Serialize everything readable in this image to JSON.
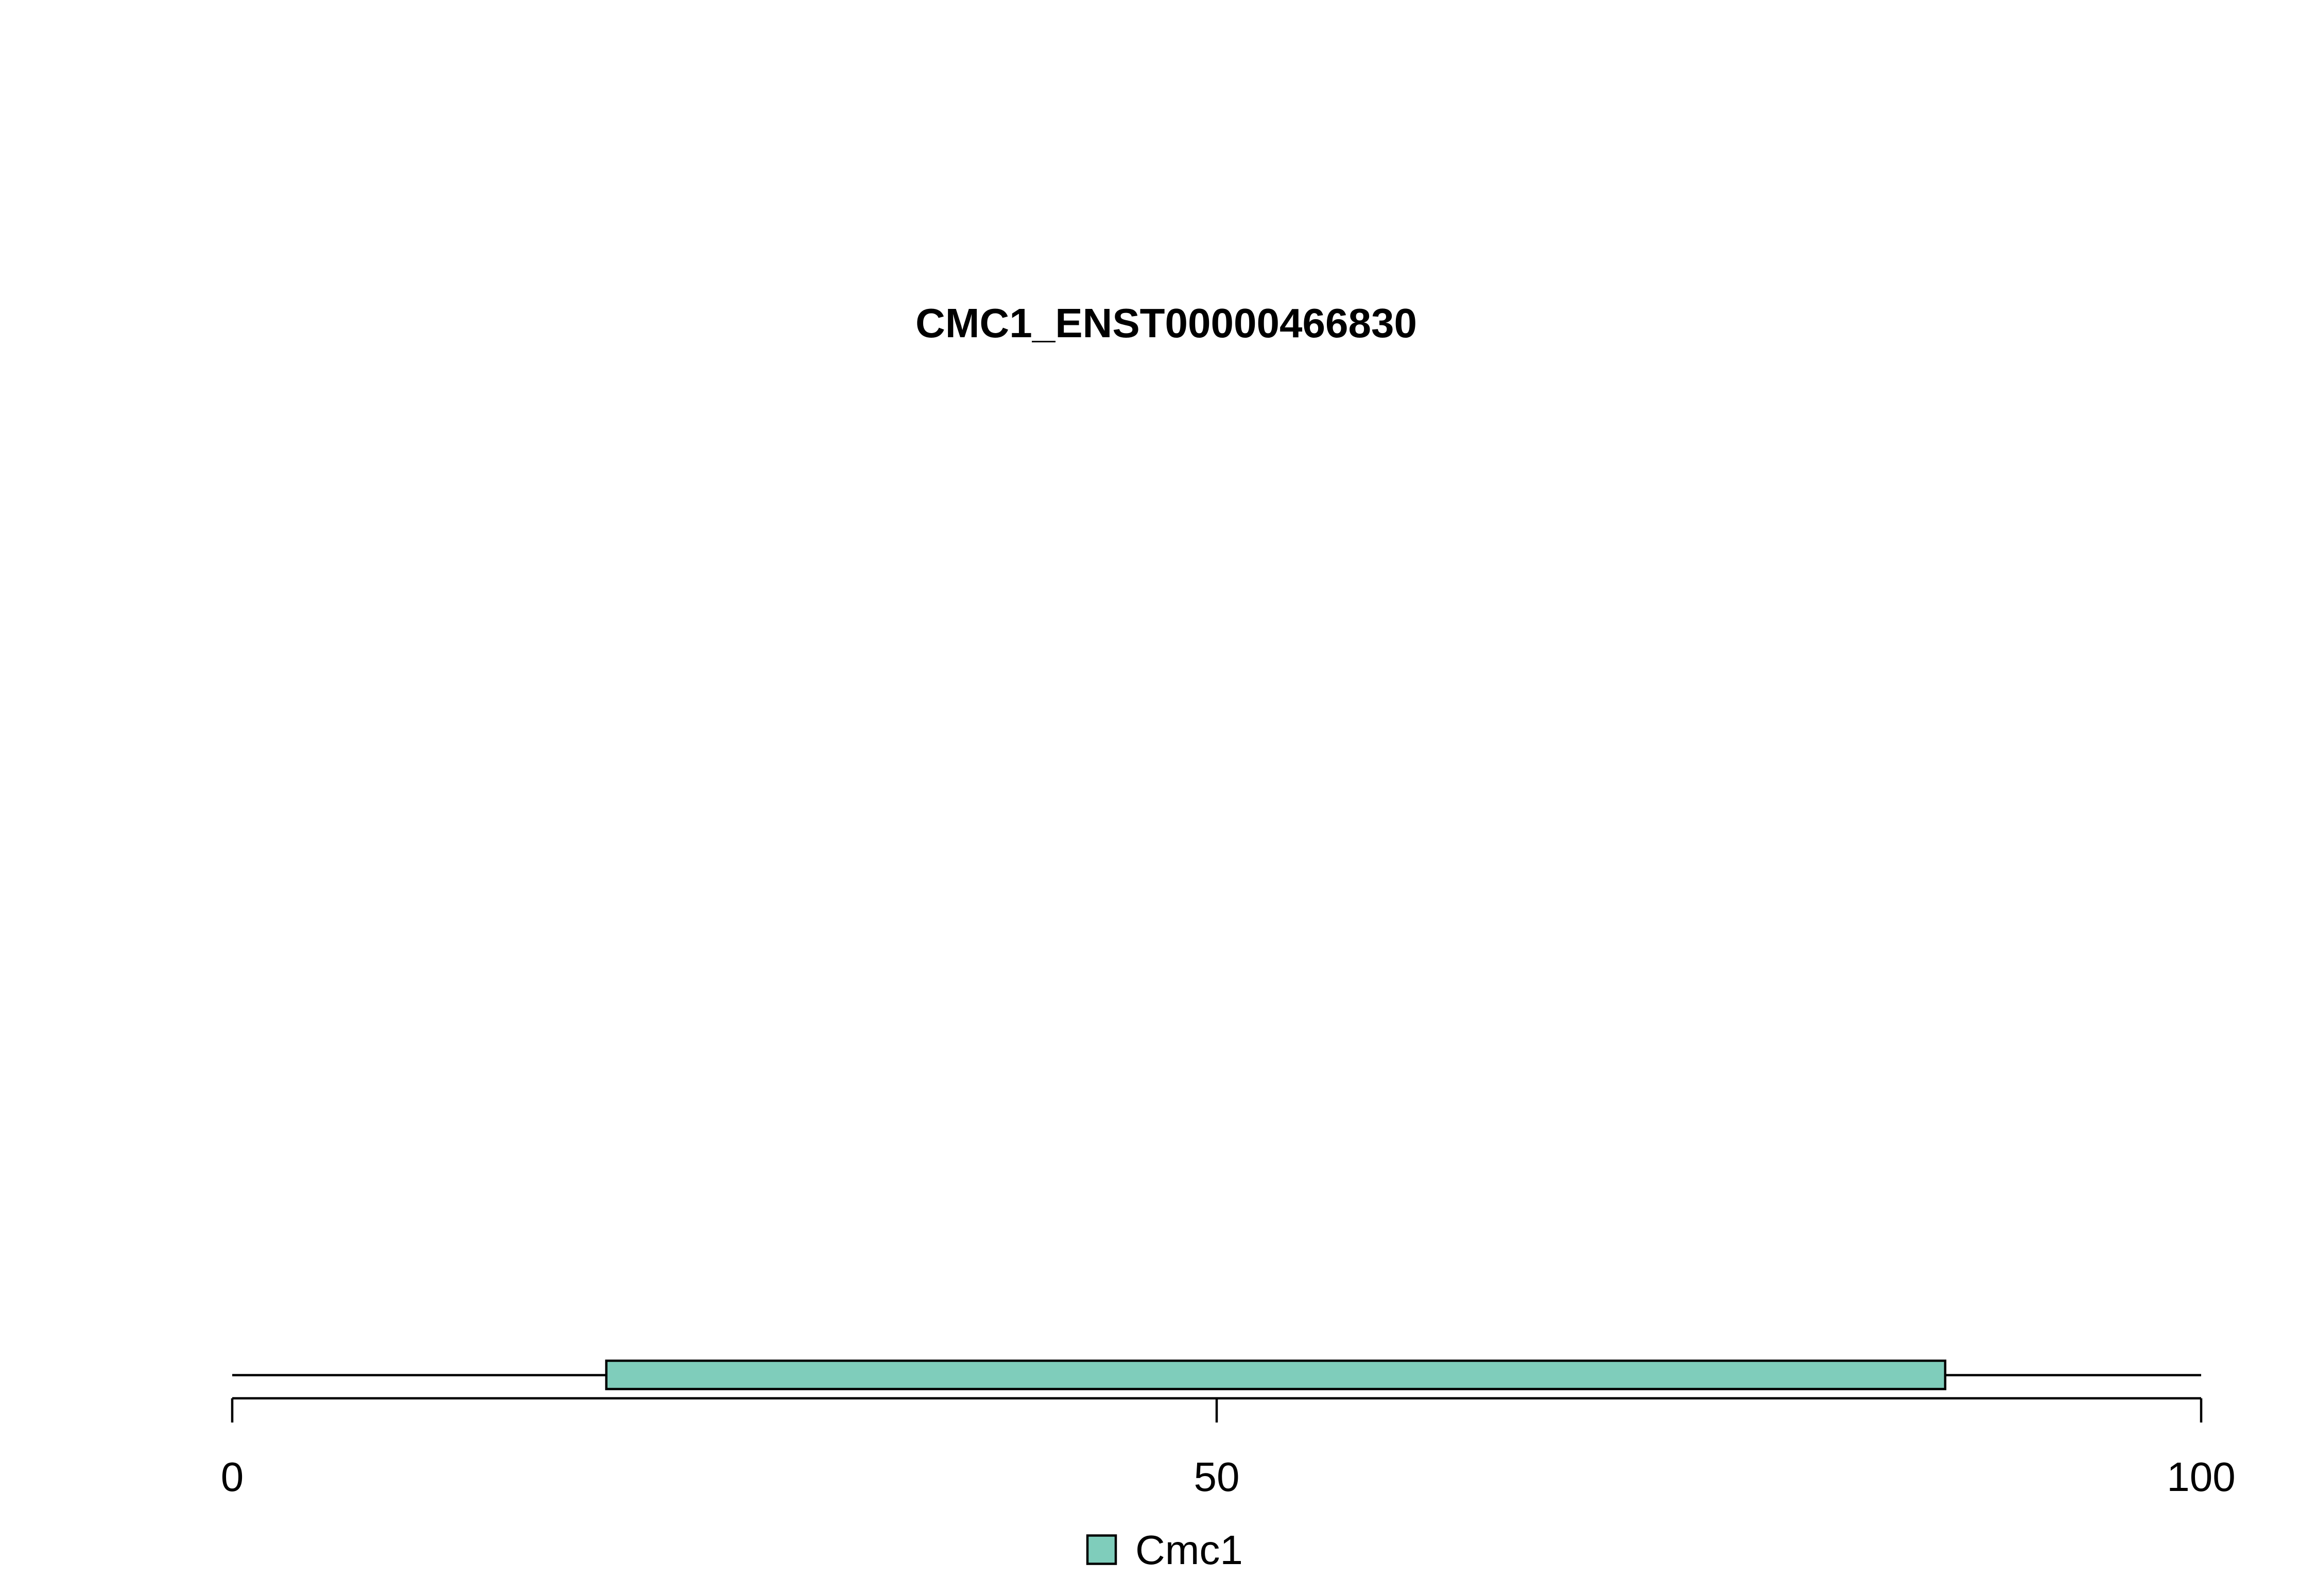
{
  "chart_data": {
    "type": "bar",
    "title": "CMC1_ENST00000466830",
    "xlabel": "",
    "ylabel": "",
    "xlim": [
      0,
      100
    ],
    "x_ticks": [
      {
        "value": 0,
        "label": "0"
      },
      {
        "value": 50,
        "label": "50"
      },
      {
        "value": 100,
        "label": "100"
      }
    ],
    "backbone": {
      "start": 0,
      "end": 100
    },
    "domains": [
      {
        "name": "Cmc1",
        "start": 19,
        "end": 87,
        "color": "#7fcdbb"
      }
    ],
    "legend": {
      "placement": "bottom-center",
      "entries": [
        {
          "label": "Cmc1",
          "color": "#7fcdbb"
        }
      ]
    },
    "grid": false
  }
}
